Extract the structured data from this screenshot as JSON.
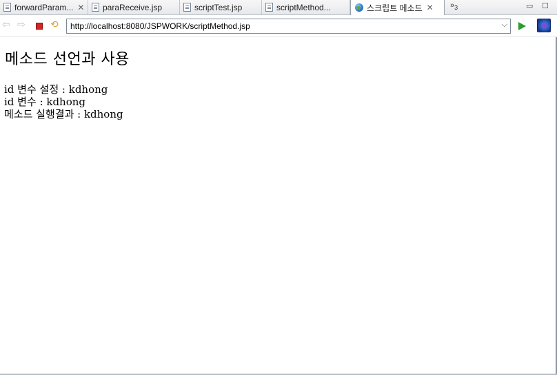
{
  "tabs": [
    {
      "label": "forwardParam...",
      "icon": "jsp-file-icon",
      "closable": true,
      "active": false
    },
    {
      "label": "paraReceive.jsp",
      "icon": "jsp-file-icon",
      "closable": false,
      "active": false
    },
    {
      "label": "scriptTest.jsp",
      "icon": "jsp-file-icon",
      "closable": false,
      "active": false
    },
    {
      "label": "scriptMethod...",
      "icon": "jsp-file-icon",
      "closable": false,
      "active": false
    },
    {
      "label": "스크립트 메소드",
      "icon": "globe-icon",
      "closable": true,
      "active": true
    }
  ],
  "tab_overflow": {
    "chevron": "»",
    "count": "3"
  },
  "address_bar": {
    "url": "http://localhost:8080/JSPWORK/scriptMethod.jsp"
  },
  "page": {
    "heading": "메소드 선언과 사용",
    "lines": [
      "id 변수 설정 : kdhong",
      "id 변수 : kdhong",
      "메소드 실행결과 : kdhong"
    ]
  },
  "colors": {
    "stop": "#d42424",
    "go": "#2c9c2c",
    "active_tab_bg": "#ffffff"
  }
}
